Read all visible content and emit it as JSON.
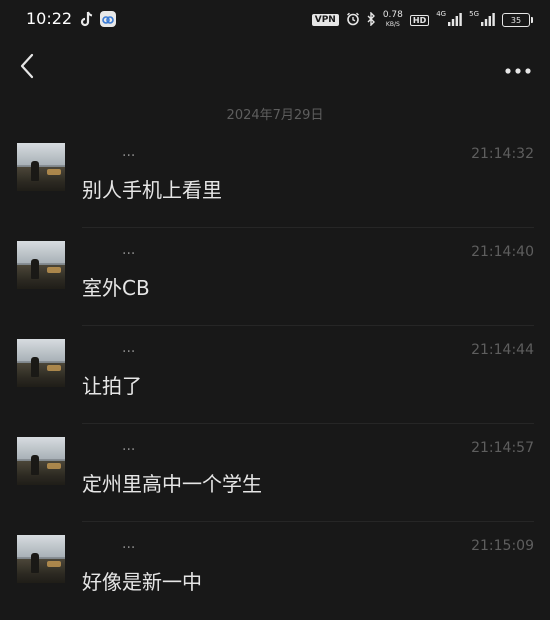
{
  "status_bar": {
    "time": "10:22",
    "app_icons": [
      "tiktok-icon",
      "app-icon"
    ],
    "vpn": "VPN",
    "net_speed_value": "0.78",
    "net_speed_unit": "KB/S",
    "hd": "HD",
    "signal_1_label": "4G",
    "signal_2_label": "5G",
    "battery": "35"
  },
  "nav": {
    "back_icon": "chevron-left-icon",
    "more_icon": "more-dots-icon"
  },
  "date_divider": "2024年7月29日",
  "messages": [
    {
      "sender": "...",
      "time": "21:14:32",
      "text": "别人手机上看里"
    },
    {
      "sender": "...",
      "time": "21:14:40",
      "text": "室外CB"
    },
    {
      "sender": "...",
      "time": "21:14:44",
      "text": "让拍了"
    },
    {
      "sender": "...",
      "time": "21:14:57",
      "text": "定州里高中一个学生"
    },
    {
      "sender": "...",
      "time": "21:15:09",
      "text": "好像是新一中"
    }
  ]
}
